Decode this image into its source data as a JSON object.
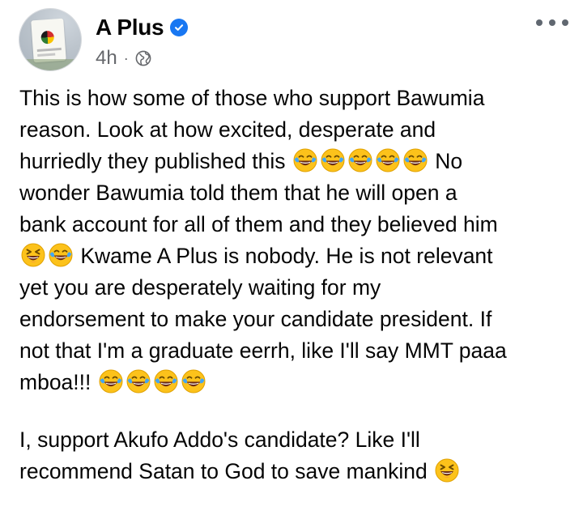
{
  "post": {
    "author": "A Plus",
    "verified": true,
    "time": "4h",
    "separator": "·",
    "audience_icon": "globe-icon",
    "more_icon": "more-options-icon",
    "lines": [
      [
        "This is how some of those who support Bawumia"
      ],
      [
        "reason. Look at how excited, desperate and"
      ],
      [
        "hurriedly they published this ",
        "😂😂😂😂😂",
        " No"
      ],
      [
        "wonder Bawumia told them that he will open a"
      ],
      [
        "bank account for all of them and they believed him"
      ],
      [
        "",
        "😆😂",
        " Kwame A Plus is nobody. He is not relevant"
      ],
      [
        "yet you are desperately waiting for my"
      ],
      [
        "endorsement to make your candidate president. If"
      ],
      [
        "not that I'm a graduate eerrh, like I'll say MMT paaa"
      ],
      [
        "mboa!!! ",
        "😂😂😂😂",
        ""
      ],
      [
        "I, support Akufo Addo's candidate? Like I'll"
      ],
      [
        "recommend Satan to God to save mankind ",
        "😆",
        ""
      ]
    ]
  },
  "colors": {
    "verified_badge": "#1877f2",
    "meta_text": "#65676b",
    "body_text": "#050505"
  }
}
